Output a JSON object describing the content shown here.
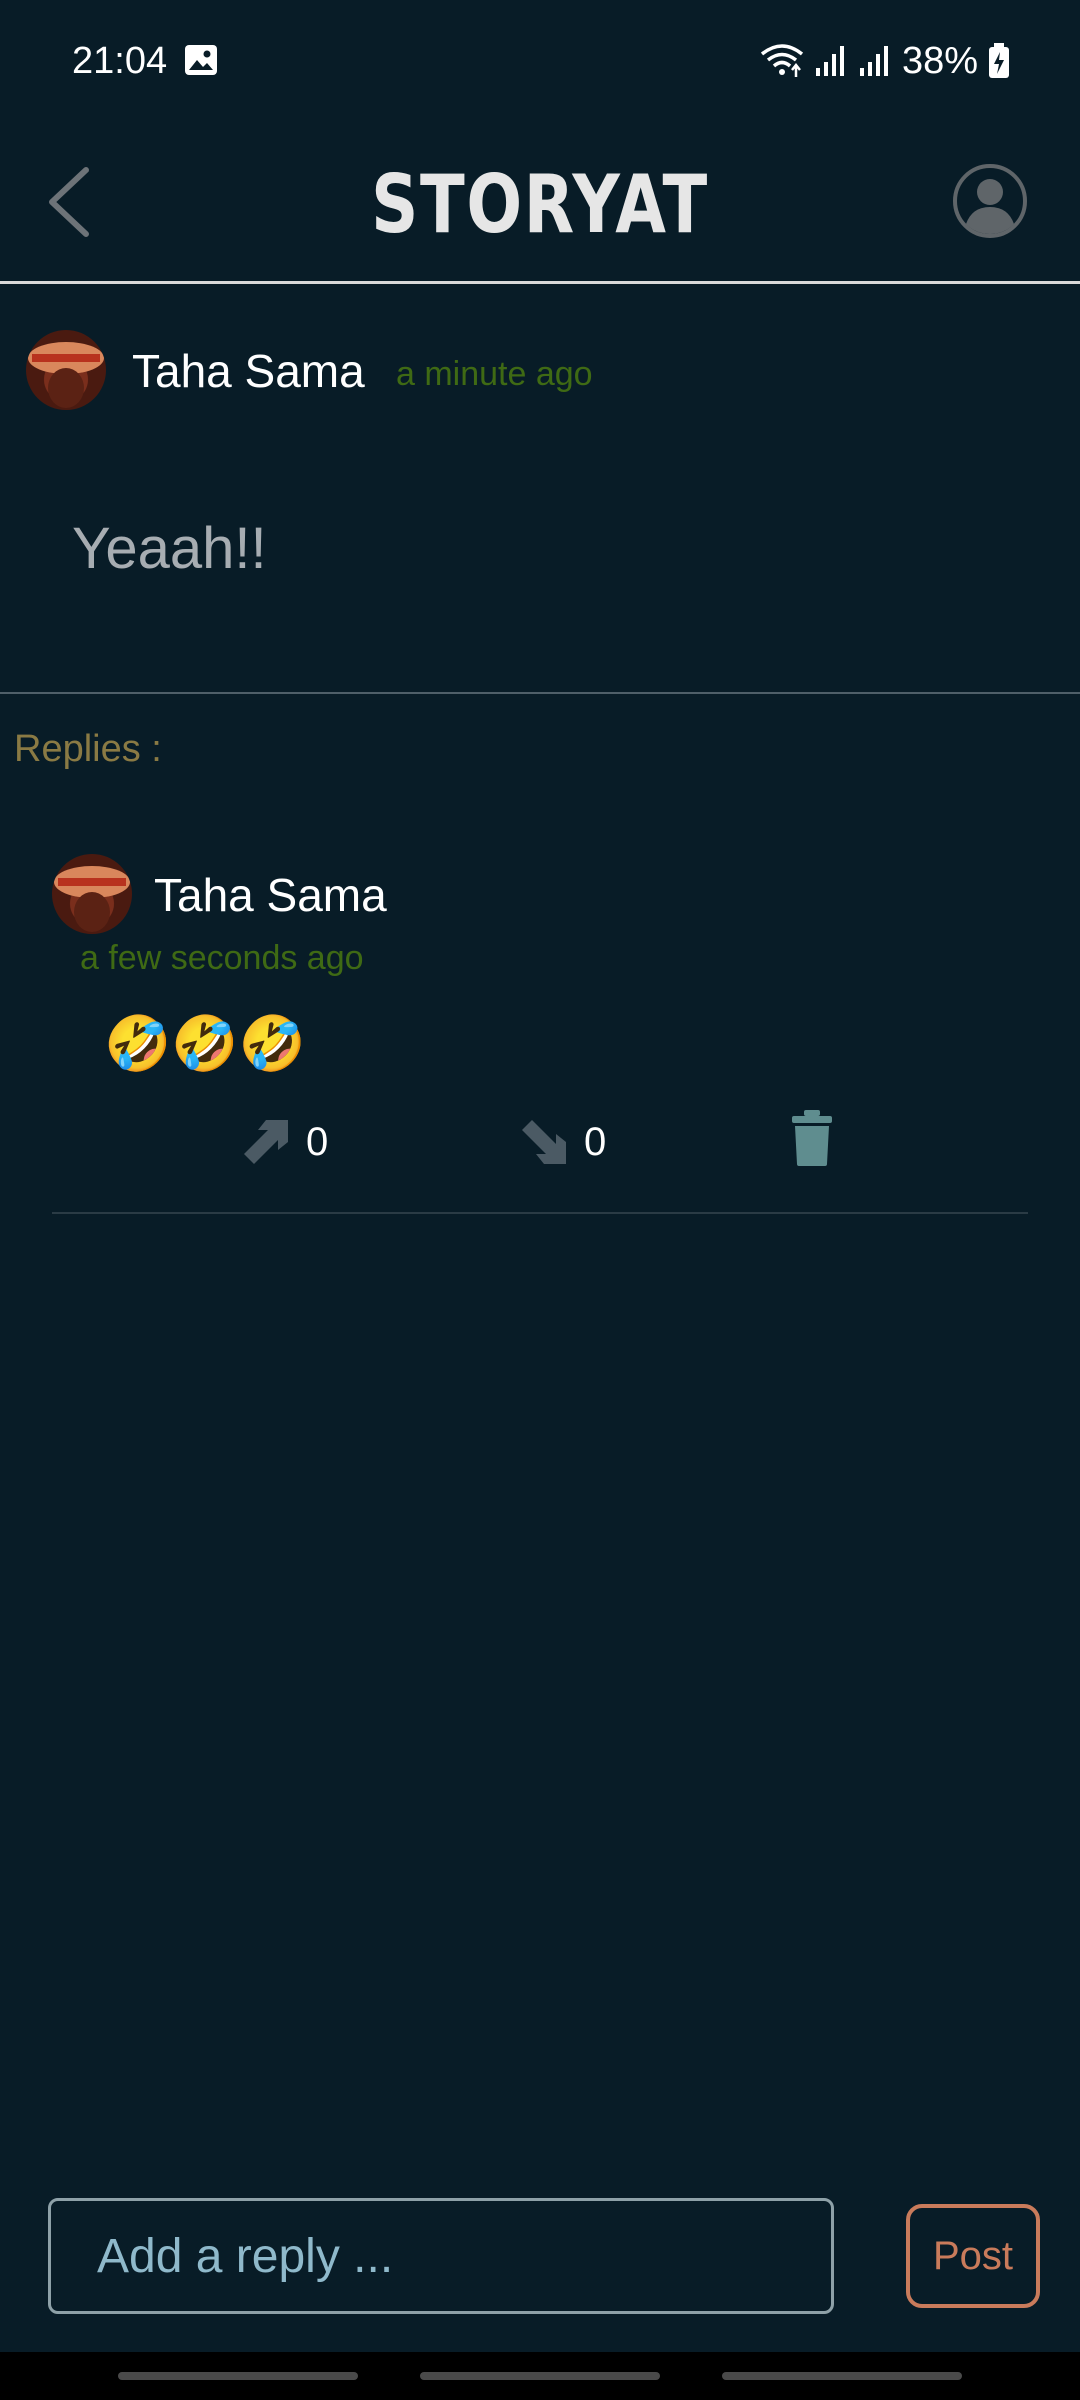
{
  "status_bar": {
    "time": "21:04",
    "battery": "38%",
    "icons": [
      "image-icon",
      "wifi-icon",
      "signal-icon",
      "signal-icon",
      "battery-charging-icon"
    ]
  },
  "app_bar": {
    "title": "STORYAT",
    "back_icon": "chevron-left-icon",
    "profile_icon": "account-circle-icon"
  },
  "post": {
    "author": "Taha Sama",
    "time": "a minute ago",
    "text": "Yeaah!!"
  },
  "replies": {
    "label": "Replies :",
    "items": [
      {
        "author": "Taha Sama",
        "time": "a few seconds ago",
        "text": "🤣🤣🤣",
        "likes": "0",
        "dislikes": "0"
      }
    ]
  },
  "composer": {
    "placeholder": "Add a reply ...",
    "post_label": "Post"
  },
  "colors": {
    "background": "#081c27",
    "time_green": "#3f6a14",
    "replies_label": "#8a7a44",
    "post_button": "#c97b5b",
    "icon_gray": "#4b5a64",
    "trash_teal": "#5f8d8f"
  }
}
